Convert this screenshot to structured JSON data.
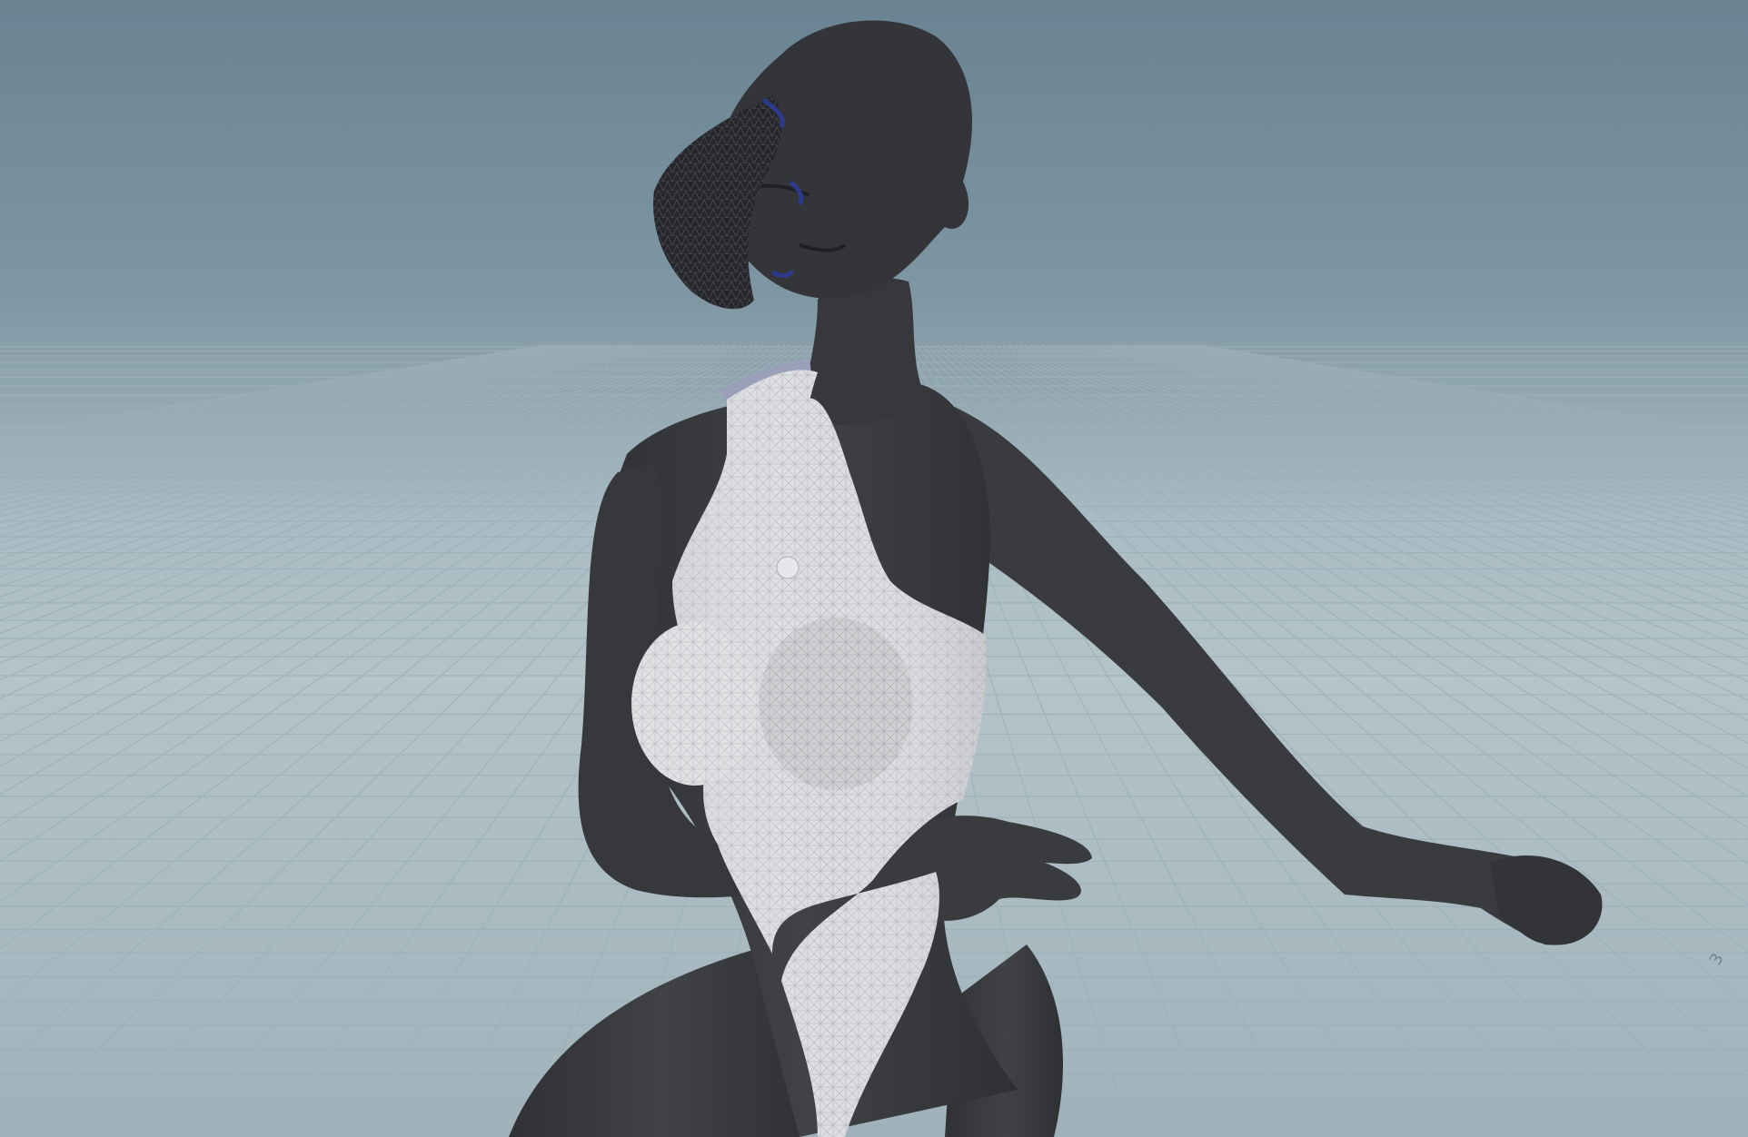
{
  "viewport": {
    "background_top": "#6a8392",
    "background_horizon": "#b4c4c9",
    "grid_color": "#97aab2"
  },
  "scene": {
    "subject": "posed-female-character-mesh",
    "body_color": "#3a3c40",
    "garment_color": "#d9dadc",
    "hair_mesh_color": "#2b2c2f",
    "hair_accent_color": "#2d3a8c"
  },
  "grid_axis_label": "3"
}
